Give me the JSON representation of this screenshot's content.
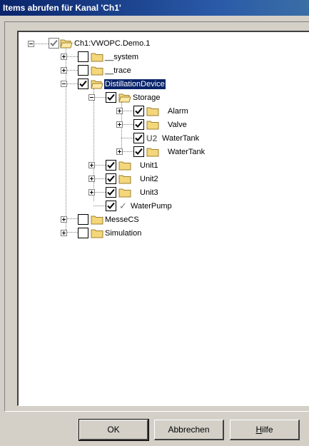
{
  "window": {
    "title": "Items abrufen für Kanal 'Ch1'"
  },
  "tree": {
    "root": "Ch1:VWOPC.Demo.1",
    "items": {
      "system": "__system",
      "trace": "__trace",
      "distillation": "DistillationDevice",
      "storage": "Storage",
      "alarm": "Alarm",
      "valve": "Valve",
      "watertank1": "WaterTank",
      "watertank2": "WaterTank",
      "unit1": "Unit1",
      "unit2": "Unit2",
      "unit3": "Unit3",
      "waterpump": "WaterPump",
      "messecs": "MesseCS",
      "simulation": "Simulation"
    },
    "badge_u2": "U2"
  },
  "buttons": {
    "ok": "OK",
    "cancel": "Abbrechen",
    "help_underlined": "H",
    "help_rest": "ilfe"
  },
  "colors": {
    "titlebar": "#0a246a",
    "selection": "#0a246a",
    "folder": "#f4d77a"
  }
}
